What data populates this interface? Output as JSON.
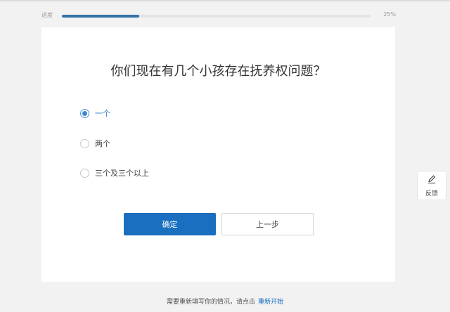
{
  "progress": {
    "label": "进度",
    "percent_text": "25%",
    "value": 0.25
  },
  "question": {
    "title": "你们现在有几个小孩存在抚养权问题？"
  },
  "options": [
    {
      "label": "一个",
      "selected": true
    },
    {
      "label": "两个",
      "selected": false
    },
    {
      "label": "三个及三个以上",
      "selected": false
    }
  ],
  "buttons": {
    "confirm": "确定",
    "back": "上一步"
  },
  "feedback": {
    "label": "反馈",
    "icon": "pencil-icon"
  },
  "footer": {
    "text": "需要重新填写你的情况，请点击",
    "link": "重新开始"
  },
  "colors": {
    "accent": "#1a6fc0",
    "progress": "#3572a8",
    "selected_text": "#2e7bc8"
  }
}
